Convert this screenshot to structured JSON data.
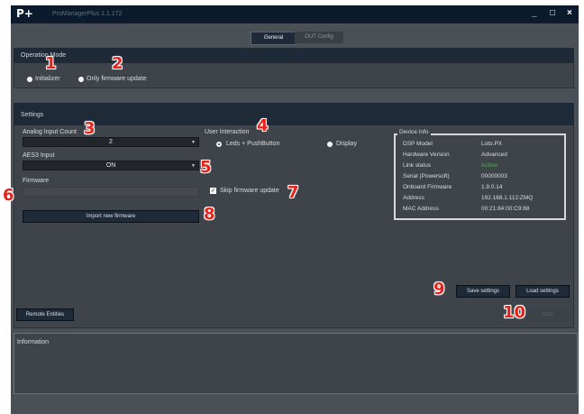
{
  "app": {
    "logo": "P+",
    "title": "ProManagerPlus 1.1.172"
  },
  "window_controls": {
    "minimize": "_",
    "maximize": "□",
    "close": "×"
  },
  "tabs": [
    {
      "label": "General"
    },
    {
      "label": "OUT Config"
    }
  ],
  "operation_mode": {
    "title": "Operation Mode",
    "options": [
      {
        "label": "Initializer",
        "selected": true
      },
      {
        "label": "Only firmware update",
        "selected": false
      }
    ]
  },
  "settings": {
    "title": "Settings",
    "analog_input_count": {
      "label": "Analog Input Count",
      "value": "2"
    },
    "aes3_input": {
      "label": "AES3 Input",
      "value": "ON"
    },
    "firmware": {
      "label": "Firmware",
      "value": ""
    },
    "import_button": "Import new firmware",
    "user_interaction": {
      "label": "User Interaction",
      "options": [
        {
          "label": "Leds + PushButton",
          "selected": false
        },
        {
          "label": "Display",
          "selected": false
        }
      ]
    },
    "skip_firmware_update": {
      "label": "Skip firmware update",
      "checked": true
    },
    "device_info": {
      "title": "Device Info",
      "rows": [
        {
          "key": "DSP Model",
          "value": "Loto.PX"
        },
        {
          "key": "Hardware Version",
          "value": "Advanced"
        },
        {
          "key": "Link status",
          "value": "Active"
        },
        {
          "key": "Serial (Powersoft)",
          "value": "00000003"
        },
        {
          "key": "Onboard Firmware",
          "value": "1.9.0.14"
        },
        {
          "key": "Address",
          "value": "192.168.1.112:ZMQ"
        },
        {
          "key": "MAC Address",
          "value": "00:21:84:00:C9:88"
        }
      ],
      "active_color": "#4caf50"
    }
  },
  "buttons": {
    "save_settings": "Save settings",
    "load_settings": "Load settings",
    "remote_entities": "Remote Entities",
    "start": "Start"
  },
  "information": {
    "title": "Information"
  },
  "callouts": [
    "1",
    "2",
    "3",
    "4",
    "5",
    "6",
    "7",
    "8",
    "9",
    "10"
  ],
  "colors": {
    "titlebar": "#0b1a2c",
    "panel_header": "#1f2a38",
    "callout": "#e8231b"
  }
}
